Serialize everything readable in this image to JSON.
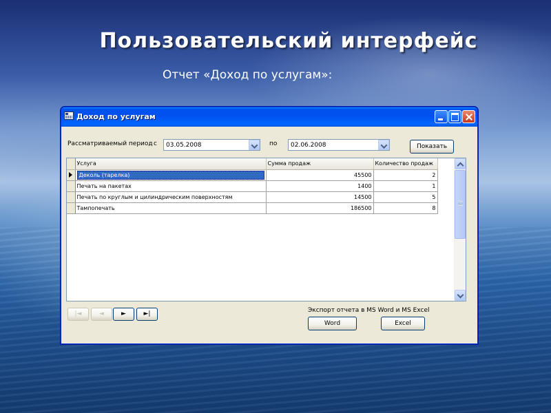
{
  "slide": {
    "title": "Пользовательский интерфейс",
    "subtitle": "Отчет «Доход по услугам»:"
  },
  "window": {
    "title": "Доход по услугам"
  },
  "filters": {
    "period_label": "Рассматриваемый период",
    "from_label": "с",
    "from_value": "03.05.2008",
    "to_label": "по",
    "to_value": "02.06.2008",
    "show_button": "Показать"
  },
  "grid": {
    "headers": [
      "Услуга",
      "Сумма продаж",
      "Количество продаж"
    ],
    "rows": [
      {
        "service": "Деколь (тарелка)",
        "sum": "45500",
        "count": "2"
      },
      {
        "service": "Печать на пакетах",
        "sum": "1400",
        "count": "1"
      },
      {
        "service": "Печать по круглым и цилиндрическим поверхностям",
        "sum": "14500",
        "count": "5"
      },
      {
        "service": "Тампопечать",
        "sum": "186500",
        "count": "8"
      }
    ],
    "selected_row": 0
  },
  "navigation": {
    "first": "|◄",
    "prev": "◄",
    "next": "►",
    "last": "►|"
  },
  "export": {
    "label": "Экспорт отчета в MS Word и MS Excel",
    "word_button": "Word",
    "excel_button": "Excel"
  }
}
